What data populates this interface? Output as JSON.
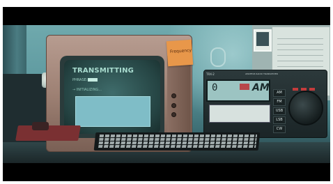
{
  "crt_screen": {
    "title": "TRANSMITTING",
    "sub_label": "PHRASE:",
    "status_line": "→ INITIALIZING..."
  },
  "sticky_note": {
    "text": "Frequency"
  },
  "radio": {
    "brand": "TRX-2",
    "model": "AMATEUR RADIO TRANSCEIVER",
    "frequency": "0",
    "mode": "AM",
    "mode_buttons": [
      "AM",
      "FM",
      "USB",
      "LSB",
      "CW"
    ]
  },
  "colors": {
    "crt_text": "#a9dccf",
    "crt_panel": "#7fbdc7",
    "sticky": "#e8974a",
    "radio_accent": "#b8464a"
  }
}
